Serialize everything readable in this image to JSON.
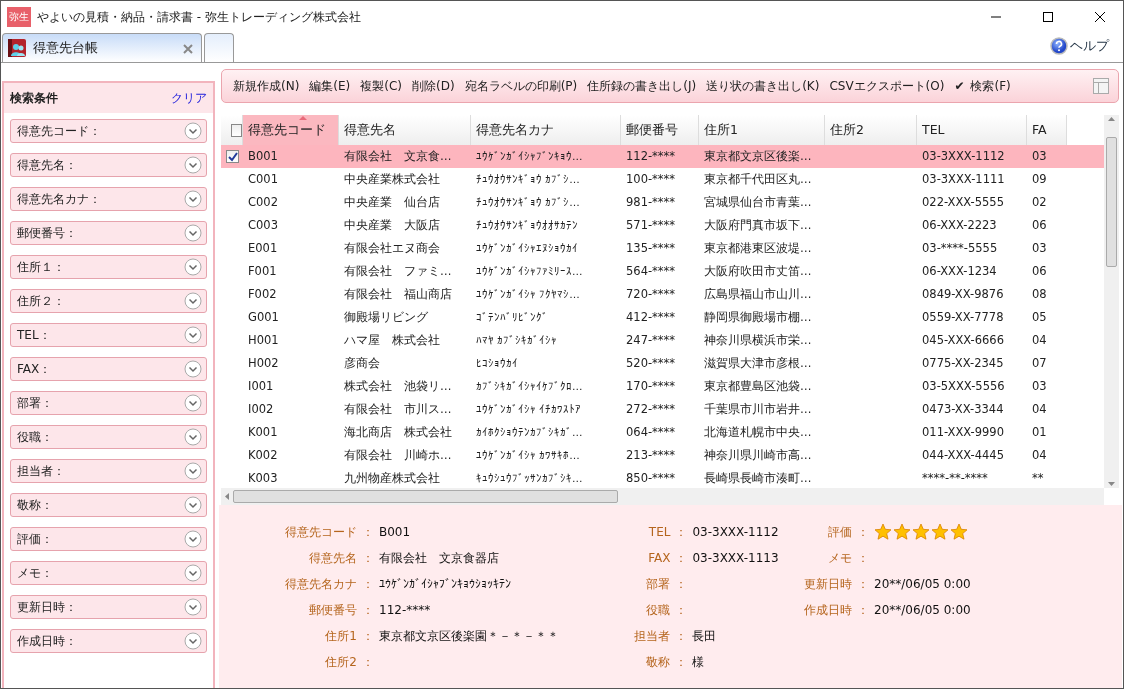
{
  "window": {
    "logo_text": "弥生",
    "title": "やよいの見積・納品・請求書 - 弥生トレーディング株式会社"
  },
  "tabs": [
    {
      "label": "得意先台帳",
      "selected": true
    }
  ],
  "help": {
    "label": "ヘルプ"
  },
  "sidebar": {
    "title": "検索条件",
    "clear": "クリア",
    "fields": [
      {
        "label": "得意先コード："
      },
      {
        "label": "得意先名："
      },
      {
        "label": "得意先名カナ："
      },
      {
        "label": "郵便番号："
      },
      {
        "label": "住所１："
      },
      {
        "label": "住所２："
      },
      {
        "label": "TEL："
      },
      {
        "label": "FAX："
      },
      {
        "label": "部署："
      },
      {
        "label": "役職："
      },
      {
        "label": "担当者："
      },
      {
        "label": "敬称："
      },
      {
        "label": "評価："
      },
      {
        "label": "メモ："
      },
      {
        "label": "更新日時："
      },
      {
        "label": "作成日時："
      }
    ]
  },
  "toolbar": [
    {
      "label": "新規作成(N)",
      "checked": false
    },
    {
      "label": "編集(E)",
      "checked": false
    },
    {
      "label": "複製(C)",
      "checked": false
    },
    {
      "label": "削除(D)",
      "checked": false
    },
    {
      "label": "宛名ラベルの印刷(P)",
      "checked": false
    },
    {
      "label": "住所録の書き出し(J)",
      "checked": false
    },
    {
      "label": "送り状の書き出し(K)",
      "checked": false
    },
    {
      "label": "CSVエクスポート(O)",
      "checked": false
    },
    {
      "label": "検索(F)",
      "checked": true,
      "mark": "✔"
    }
  ],
  "table": {
    "select_all_checked": false,
    "columns": [
      {
        "label": "得意先コード",
        "sorted": true
      },
      {
        "label": "得意先名",
        "sorted": false
      },
      {
        "label": "得意先名カナ",
        "sorted": false
      },
      {
        "label": "郵便番号",
        "sorted": false
      },
      {
        "label": "住所1",
        "sorted": false
      },
      {
        "label": "住所2",
        "sorted": false
      },
      {
        "label": "TEL",
        "sorted": false
      },
      {
        "label": "FA",
        "sorted": false
      }
    ],
    "rows": [
      {
        "selected": true,
        "checked": true,
        "code": "B001",
        "name": "有限会社　文京食…",
        "kana": "ﾕｳｹﾞﾝｶﾞｲｼｬﾌﾞﾝｷｮｳ…",
        "zip": "112-****",
        "address1": "東京都文京区後楽…",
        "tel": "03-3XXX-1112",
        "fax": "03"
      },
      {
        "selected": false,
        "checked": false,
        "code": "C001",
        "name": "中央産業株式会社",
        "kana": "ﾁｭｳｵｳｻﾝｷﾞｮｳ ｶﾌﾞｼ…",
        "zip": "100-****",
        "address1": "東京都千代田区丸…",
        "tel": "03-3XXX-1111",
        "fax": "09"
      },
      {
        "selected": false,
        "checked": false,
        "code": "C002",
        "name": "中央産業　仙台店",
        "kana": "ﾁｭｳｵｳｻﾝｷﾞｮｳ ｶﾌﾞｼ…",
        "zip": "981-****",
        "address1": "宮城県仙台市青葉…",
        "tel": "022-XXX-5555",
        "fax": "02"
      },
      {
        "selected": false,
        "checked": false,
        "code": "C003",
        "name": "中央産業　大阪店",
        "kana": "ﾁｭｳｵｳｻﾝｷﾞｮｳｵｵｻｶﾃﾝ",
        "zip": "571-****",
        "address1": "大阪府門真市坂下…",
        "tel": "06-XXX-2223",
        "fax": "06"
      },
      {
        "selected": false,
        "checked": false,
        "code": "E001",
        "name": "有限会社エヌ商会",
        "kana": "ﾕｳｹﾞﾝｶﾞｲｼｬｴﾇｼｮｳｶｲ",
        "zip": "135-****",
        "address1": "東京都港東区波堤…",
        "tel": "03-****-5555",
        "fax": "03"
      },
      {
        "selected": false,
        "checked": false,
        "code": "F001",
        "name": "有限会社　ファミ…",
        "kana": "ﾕｳｹﾞﾝｶﾞｲｼｬﾌｧﾐﾘｰｽ…",
        "zip": "564-****",
        "address1": "大阪府吹田市丈笛…",
        "tel": "06-XXX-1234",
        "fax": "06"
      },
      {
        "selected": false,
        "checked": false,
        "code": "F002",
        "name": "有限会社　福山商店",
        "kana": "ﾕｳｹﾞﾝｶﾞｲｼｬ ﾌｸﾔﾏｼ…",
        "zip": "720-****",
        "address1": "広島県福山市山川…",
        "tel": "0849-XX-9876",
        "fax": "08"
      },
      {
        "selected": false,
        "checked": false,
        "code": "G001",
        "name": "御殿場リビング",
        "kana": "ｺﾞﾃﾝﾊﾞﾘﾋﾞﾝｸﾞ",
        "zip": "412-****",
        "address1": "静岡県御殿場市棚…",
        "tel": "0559-XX-7778",
        "fax": "05"
      },
      {
        "selected": false,
        "checked": false,
        "code": "H001",
        "name": "ハマ屋　株式会社",
        "kana": "ﾊﾏﾔ ｶﾌﾞｼｷｶﾞｲｼｬ",
        "zip": "247-****",
        "address1": "神奈川県横浜市栄…",
        "tel": "045-XXX-6666",
        "fax": "04"
      },
      {
        "selected": false,
        "checked": false,
        "code": "H002",
        "name": "彦商会",
        "kana": "ﾋｺｼｮｳｶｲ",
        "zip": "520-****",
        "address1": "滋賀県大津市彦根…",
        "tel": "0775-XX-2345",
        "fax": "07"
      },
      {
        "selected": false,
        "checked": false,
        "code": "I001",
        "name": "株式会社　池袋リ…",
        "kana": "ｶﾌﾞｼｷｶﾞｲｼｬｲｹﾌﾞｸﾛ…",
        "zip": "170-****",
        "address1": "東京都豊島区池袋…",
        "tel": "03-5XXX-5556",
        "fax": "03"
      },
      {
        "selected": false,
        "checked": false,
        "code": "I002",
        "name": "有限会社　市川ス…",
        "kana": "ﾕｳｹﾞﾝｶﾞｲｼｬ ｲﾁｶﾜｽﾄｱ",
        "zip": "272-****",
        "address1": "千葉県市川市岩井…",
        "tel": "0473-XX-3344",
        "fax": "04"
      },
      {
        "selected": false,
        "checked": false,
        "code": "K001",
        "name": "海北商店　株式会社",
        "kana": "ｶｲﾎｸｼｮｳﾃﾝｶﾌﾞｼｷｶﾞ…",
        "zip": "064-****",
        "address1": "北海道札幌市中央…",
        "tel": "011-XXX-9990",
        "fax": "01"
      },
      {
        "selected": false,
        "checked": false,
        "code": "K002",
        "name": "有限会社　川崎ホ…",
        "kana": "ﾕｳｹﾞﾝｶﾞｲｼｬ ｶﾜｻｷﾎ…",
        "zip": "213-****",
        "address1": "神奈川県川崎市高…",
        "tel": "044-XXX-4445",
        "fax": "04"
      },
      {
        "selected": false,
        "checked": false,
        "code": "K003",
        "name": "九州物産株式会社",
        "kana": "ｷｭｳｼｭｳﾌﾞｯｻﾝｶﾌﾞｼｷ…",
        "zip": "850-****",
        "address1": "長崎県長崎市湊町…",
        "tel": "****-**-****",
        "fax": "**"
      }
    ]
  },
  "detail": {
    "columns": [
      [
        {
          "label": "得意先コード",
          "colon": "：",
          "value": "B001"
        },
        {
          "label": "得意先名",
          "colon": "：",
          "value": "有限会社　文京食器店"
        },
        {
          "label": "得意先名カナ",
          "colon": "：",
          "value": "ﾕｳｹﾞﾝｶﾞｲｼｬﾌﾞﾝｷｮｳｼｮｯｷﾃﾝ"
        },
        {
          "label": "郵便番号",
          "colon": "：",
          "value": "112-****"
        },
        {
          "label": "住所1",
          "colon": "：",
          "value": "東京都文京区後楽園＊－＊－＊＊"
        },
        {
          "label": "住所2",
          "colon": "："
        }
      ],
      [
        {
          "label": "TEL",
          "colon": "：",
          "value": "03-3XXX-1112"
        },
        {
          "label": "FAX",
          "colon": "：",
          "value": "03-3XXX-1113"
        },
        {
          "label": "部署",
          "colon": "："
        },
        {
          "label": "役職",
          "colon": "："
        },
        {
          "label": "担当者",
          "colon": "：",
          "value": "長田"
        },
        {
          "label": "敬称",
          "colon": "：",
          "value": "様"
        }
      ],
      [
        {
          "label": "評価",
          "colon": "：",
          "kind": "stars",
          "stars": 5
        },
        {
          "label": "メモ",
          "colon": "："
        },
        {
          "label": "更新日時",
          "colon": "：",
          "value": "20**/06/05 0:00"
        },
        {
          "label": "作成日時",
          "colon": "：",
          "value": "20**/06/05 0:00"
        }
      ]
    ]
  }
}
